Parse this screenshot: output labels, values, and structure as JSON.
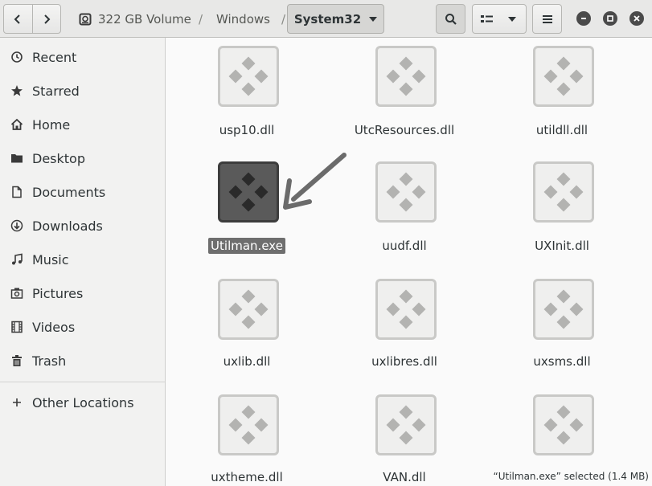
{
  "breadcrumbs": {
    "drive": "322 GB Volume",
    "folder1": "Windows",
    "current": "System32"
  },
  "sidebar": {
    "items": [
      {
        "label": "Recent",
        "icon": "clock-icon"
      },
      {
        "label": "Starred",
        "icon": "star-icon"
      },
      {
        "label": "Home",
        "icon": "home-icon"
      },
      {
        "label": "Desktop",
        "icon": "folder-icon"
      },
      {
        "label": "Documents",
        "icon": "document-icon"
      },
      {
        "label": "Downloads",
        "icon": "download-icon"
      },
      {
        "label": "Music",
        "icon": "music-icon"
      },
      {
        "label": "Pictures",
        "icon": "picture-icon"
      },
      {
        "label": "Videos",
        "icon": "video-icon"
      },
      {
        "label": "Trash",
        "icon": "trash-icon"
      }
    ],
    "other": "Other Locations"
  },
  "files": [
    {
      "name": "usp10.dll"
    },
    {
      "name": "UtcResources.dll"
    },
    {
      "name": "utildll.dll"
    },
    {
      "name": "Utilman.exe",
      "selected": true
    },
    {
      "name": "uudf.dll"
    },
    {
      "name": "UXInit.dll"
    },
    {
      "name": "uxlib.dll"
    },
    {
      "name": "uxlibres.dll"
    },
    {
      "name": "uxsms.dll"
    },
    {
      "name": "uxtheme.dll"
    },
    {
      "name": "VAN.dll"
    },
    {
      "name": ""
    }
  ],
  "status": "“Utilman.exe” selected (1.4 MB)"
}
